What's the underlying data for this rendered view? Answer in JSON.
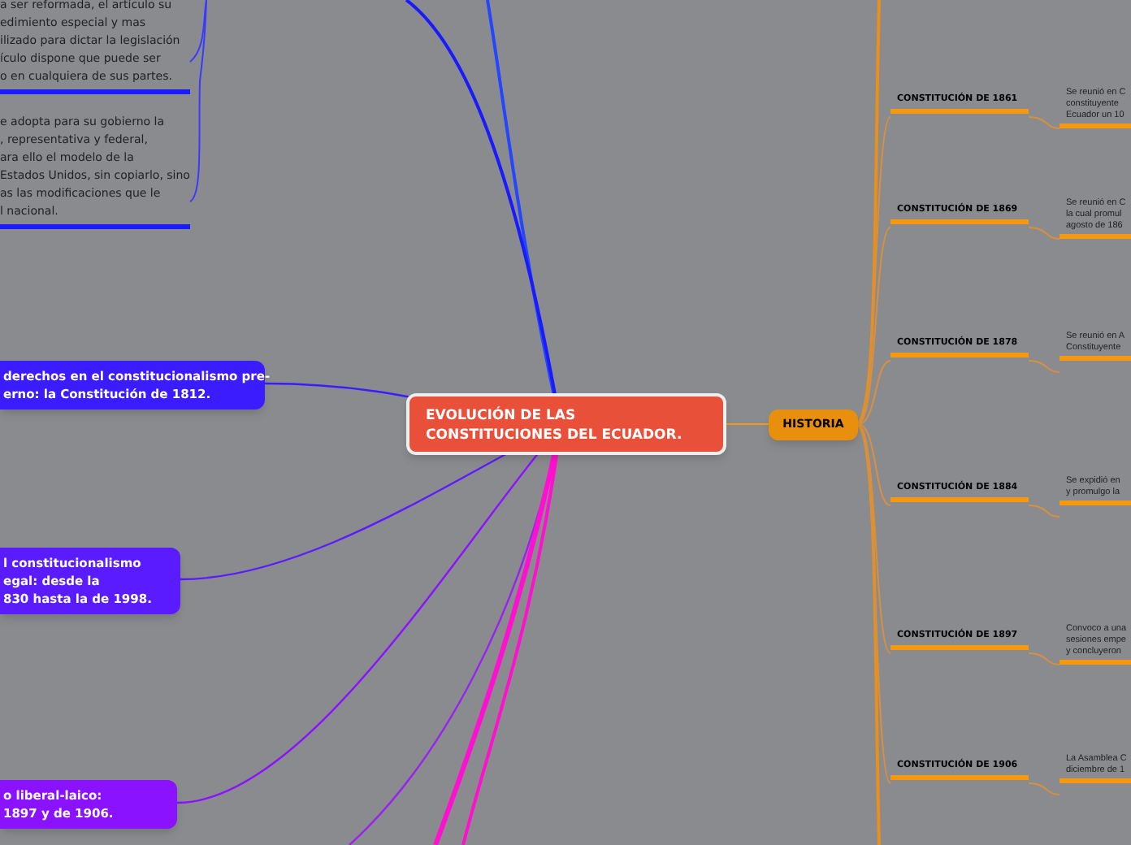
{
  "center": {
    "title": "EVOLUCIÓN DE LAS CONSTITUCIONES DEL ECUADOR."
  },
  "left_notes": [
    {
      "lines": [
        "a ser reformada, el artículo su",
        "edimiento especial y mas",
        "ilizado para dictar la legislación",
        "ículo dispone que puede ser",
        "o en cualquiera de sus partes."
      ]
    },
    {
      "lines": [
        "e adopta para su gobierno la",
        ", representativa y federal,",
        "ara ello el modelo de la",
        "Estados Unidos, sin copiarlo, sino",
        "as las modificaciones que le",
        "l nacional."
      ]
    }
  ],
  "left_topics": [
    {
      "lines": [
        "derechos en el constitucionalismo pre-",
        "erno: la Constitución de 1812."
      ],
      "color": "#3a1cff"
    },
    {
      "lines": [
        "l constitucionalismo",
        "egal: desde la",
        "830 hasta la de 1998."
      ],
      "color": "#5a1cff"
    },
    {
      "lines": [
        "o liberal-laico:",
        "1897 y de 1906."
      ],
      "color": "#8a12ff"
    }
  ],
  "branch": {
    "title": "HISTORIA"
  },
  "constitutions": [
    {
      "title": "CONSTITUCIÓN DE 1861",
      "note": [
        "Se reunió en C",
        "constituyente",
        "Ecuador un 10"
      ]
    },
    {
      "title": "CONSTITUCIÓN DE 1869",
      "note": [
        "Se reunió en C",
        "la cual promul",
        "agosto de 186"
      ]
    },
    {
      "title": "CONSTITUCIÓN DE 1878",
      "note": [
        "Se reunió en A",
        "Constituyente"
      ]
    },
    {
      "title": "CONSTITUCIÓN DE 1884",
      "note": [
        "Se expidió en",
        "y promulgo la"
      ]
    },
    {
      "title": "CONSTITUCIÓN DE 1897",
      "note": [
        "Convoco a una",
        "sesiones empe",
        "y concluyeron"
      ]
    },
    {
      "title": "CONSTITUCIÓN DE 1906",
      "note": [
        "La Asamblea C",
        "diciembre de 1"
      ]
    }
  ]
}
